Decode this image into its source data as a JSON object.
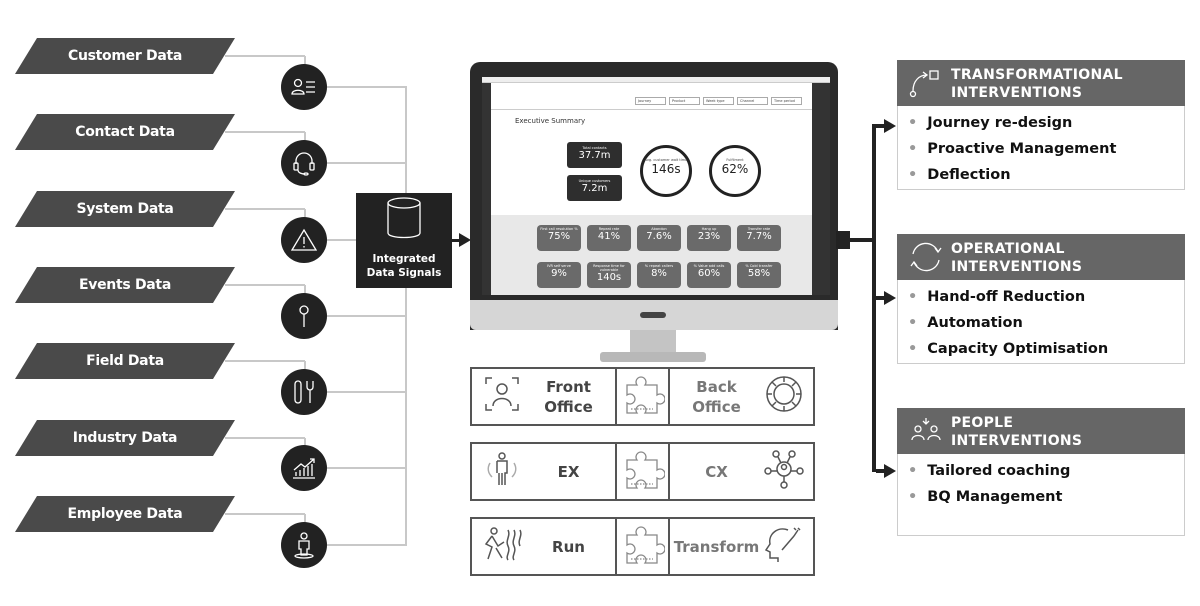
{
  "sources": [
    {
      "label": "Customer Data",
      "icon": "contact-card-icon"
    },
    {
      "label": "Contact Data",
      "icon": "headset-icon"
    },
    {
      "label": "System Data",
      "icon": "warning-icon"
    },
    {
      "label": "Events Data",
      "icon": "pin-icon"
    },
    {
      "label": "Field Data",
      "icon": "tools-icon"
    },
    {
      "label": "Industry Data",
      "icon": "growth-chart-icon"
    },
    {
      "label": "Employee Data",
      "icon": "person-icon"
    }
  ],
  "hub": {
    "line1": "Integrated",
    "line2": "Data Signals",
    "icon": "database-icon"
  },
  "dashboard": {
    "title": "Executive Summary",
    "filters": [
      "Journey",
      "Product",
      "Week type",
      "Channel",
      "Time period"
    ],
    "total_contacts": {
      "label": "Total contacts",
      "value": "37.7m"
    },
    "unique_customers": {
      "label": "Unique customers",
      "value": "7.2m"
    },
    "wait_time": {
      "label": "Avg. customer wait time",
      "value": "146s"
    },
    "fulfilment": {
      "label": "Fulfilment",
      "value": "62%"
    },
    "tiles": [
      {
        "label": "First call resolution %",
        "value": "75%"
      },
      {
        "label": "Repeat rate",
        "value": "41%"
      },
      {
        "label": "Abandon",
        "value": "7.6%"
      },
      {
        "label": "Hang up",
        "value": "23%"
      },
      {
        "label": "Transfer rate",
        "value": "7.7%"
      },
      {
        "label": "IVR self serve",
        "value": "9%"
      },
      {
        "label": "Response time for vulnerable",
        "value": "140s"
      },
      {
        "label": "% repeat callers",
        "value": "8%"
      },
      {
        "label": "% Value add calls",
        "value": "60%"
      },
      {
        "label": "% Cold transfer",
        "value": "58%"
      }
    ]
  },
  "grid": [
    {
      "left": "Front Office",
      "left_icon": "focus-person-icon",
      "right": "Back Office",
      "right_icon": "gear-ring-icon"
    },
    {
      "left": "EX",
      "left_icon": "employee-cycle-icon",
      "right": "CX",
      "right_icon": "customer-network-icon"
    },
    {
      "left": "Run",
      "left_icon": "running-person-icon",
      "right": "Transform",
      "right_icon": "head-spark-icon"
    }
  ],
  "interventions": [
    {
      "title1": "TRANSFORMATIONAL",
      "title2": "INTERVENTIONS",
      "icon": "path-icon",
      "items": [
        "Journey re-design",
        "Proactive Management",
        "Deflection"
      ]
    },
    {
      "title1": "OPERATIONAL",
      "title2": "INTERVENTIONS",
      "icon": "cycle-icon",
      "items": [
        "Hand-off Reduction",
        "Automation",
        "Capacity Optimisation"
      ]
    },
    {
      "title1": "PEOPLE",
      "title2": "INTERVENTIONS",
      "icon": "people-icon",
      "items": [
        "Tailored coaching",
        "BQ Management"
      ]
    }
  ],
  "colors": {
    "dark": "#222222",
    "panel": "#666666",
    "parallelogram": "#4a4a4a",
    "connector": "#c8c8c8"
  }
}
